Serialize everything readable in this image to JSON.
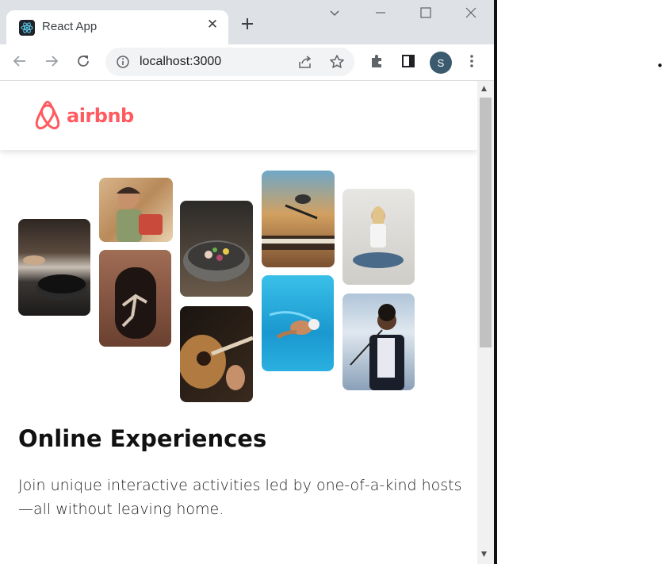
{
  "browser": {
    "tab_title": "React App",
    "url": "localhost:3000",
    "profile_initial": "S"
  },
  "page": {
    "logo_text": "airbnb",
    "brand_color": "#FF5A5F",
    "heading": "Online Experiences",
    "description": "Join unique interactive activities led by one-of-a-kind hosts—all without leaving home."
  },
  "photo_grid": [
    {
      "name": "photo-cooking"
    },
    {
      "name": "photo-woman-food"
    },
    {
      "name": "photo-dancer-doorway"
    },
    {
      "name": "photo-food-bowl"
    },
    {
      "name": "photo-guitar"
    },
    {
      "name": "photo-keyboard-mic"
    },
    {
      "name": "photo-swimmer"
    },
    {
      "name": "photo-yoga"
    },
    {
      "name": "photo-singer"
    }
  ]
}
